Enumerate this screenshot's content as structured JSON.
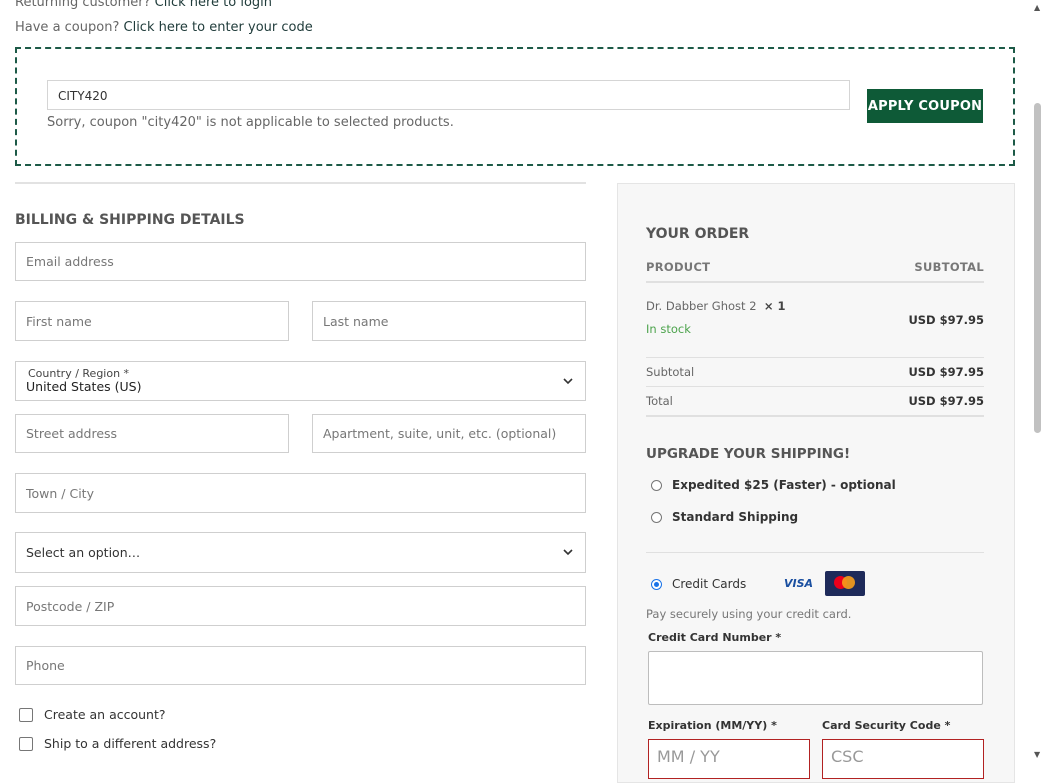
{
  "notices": {
    "returning_prefix": "Returning customer?",
    "returning_link": "Click here to login",
    "coupon_prefix": "Have a coupon?",
    "coupon_link": "Click here to enter your code"
  },
  "coupon": {
    "value": "CITY420",
    "error": "Sorry, coupon \"city420\" is not applicable to selected products.",
    "apply_label": "APPLY COUPON"
  },
  "billing": {
    "title": "BILLING & SHIPPING DETAILS",
    "email_placeholder": "Email address",
    "first_name_placeholder": "First name",
    "last_name_placeholder": "Last name",
    "country_label": "Country / Region *",
    "country_value": "United States (US)",
    "street_placeholder": "Street address",
    "apartment_placeholder": "Apartment, suite, unit, etc. (optional)",
    "city_placeholder": "Town / City",
    "state_value": "Select an option…",
    "postcode_placeholder": "Postcode / ZIP",
    "phone_placeholder": "Phone",
    "create_account_label": "Create an account?",
    "ship_different_label": "Ship to a different address?"
  },
  "order": {
    "title": "YOUR ORDER",
    "col_product": "PRODUCT",
    "col_subtotal": "SUBTOTAL",
    "item_name": "Dr. Dabber Ghost 2",
    "item_qty": "× 1",
    "item_stock": "In stock",
    "item_price": "USD $97.95",
    "subtotal_label": "Subtotal",
    "subtotal_value": "USD $97.95",
    "total_label": "Total",
    "total_value": "USD $97.95"
  },
  "shipping": {
    "title": "UPGRADE YOUR SHIPPING!",
    "option_expedited": "Expedited $25 (Faster) - optional",
    "option_standard": "Standard Shipping"
  },
  "payment": {
    "method_label": "Credit Cards",
    "visa_text": "VISA",
    "description": "Pay securely using your credit card.",
    "card_number_label": "Credit Card Number *",
    "expiration_label": "Expiration (MM/YY) *",
    "expiration_placeholder": "MM / YY",
    "csc_label": "Card Security Code *",
    "csc_placeholder": "CSC"
  },
  "colors": {
    "brand_green": "#0e5a37",
    "coupon_border": "#1d5a47",
    "in_stock": "#4ca34c",
    "error_border": "#b22222"
  }
}
